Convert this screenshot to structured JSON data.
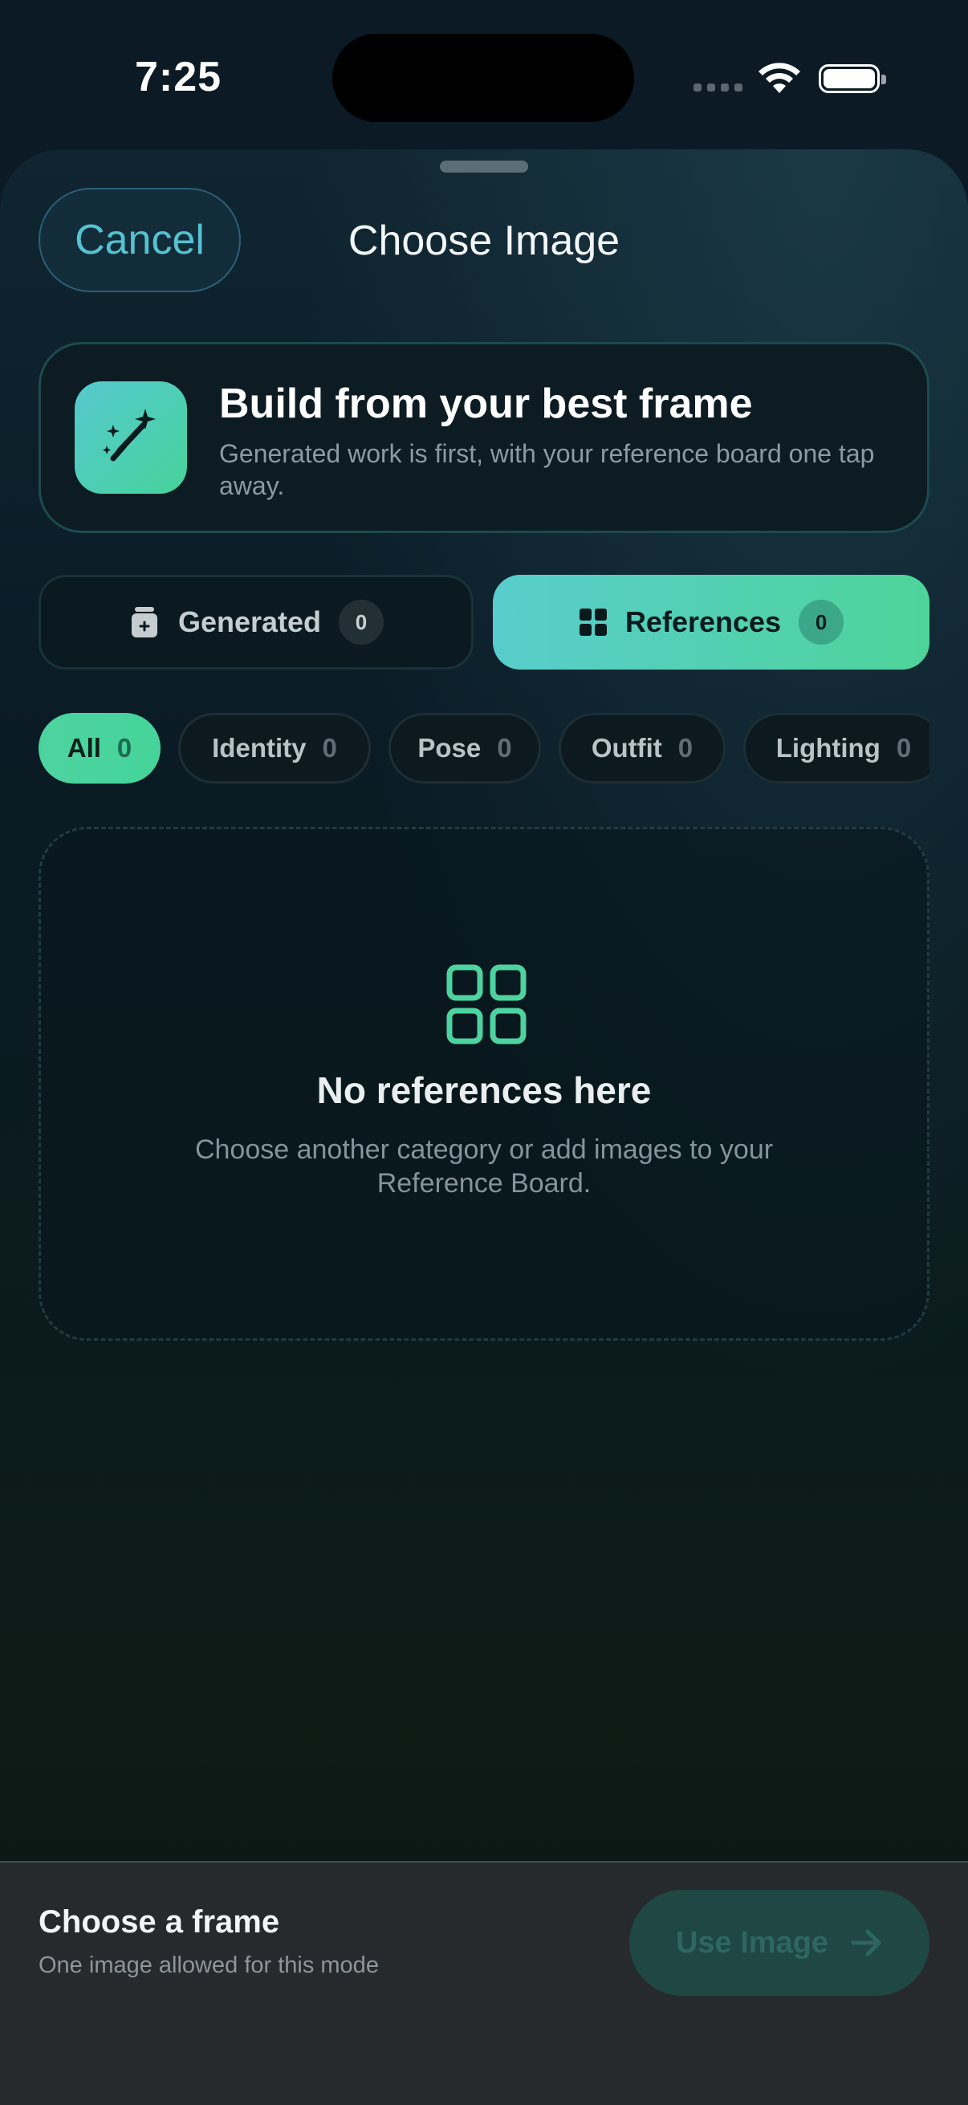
{
  "status_bar": {
    "time": "7:25"
  },
  "header": {
    "cancel_label": "Cancel",
    "title": "Choose Image"
  },
  "banner": {
    "icon": "magic-wand-icon",
    "title": "Build from your best frame",
    "subtitle": "Generated work is first, with your reference board one tap away."
  },
  "segments": [
    {
      "label": "Generated",
      "count": "0",
      "icon": "stack-icon",
      "selected": false
    },
    {
      "label": "References",
      "count": "0",
      "icon": "grid-icon",
      "selected": true
    }
  ],
  "filters": [
    {
      "label": "All",
      "count": "0",
      "selected": true
    },
    {
      "label": "Identity",
      "count": "0",
      "selected": false
    },
    {
      "label": "Pose",
      "count": "0",
      "selected": false
    },
    {
      "label": "Outfit",
      "count": "0",
      "selected": false
    },
    {
      "label": "Lighting",
      "count": "0",
      "selected": false
    }
  ],
  "empty_state": {
    "icon": "grid-icon",
    "title": "No references here",
    "subtitle": "Choose another category or add images to your Reference Board."
  },
  "bottom_bar": {
    "title": "Choose a frame",
    "subtitle": "One image allowed for this mode",
    "action_label": "Use Image",
    "action_enabled": false
  },
  "colors": {
    "accent_teal": "#58cdcc",
    "accent_green": "#4ed49a",
    "cancel_text": "#55c2d0"
  }
}
